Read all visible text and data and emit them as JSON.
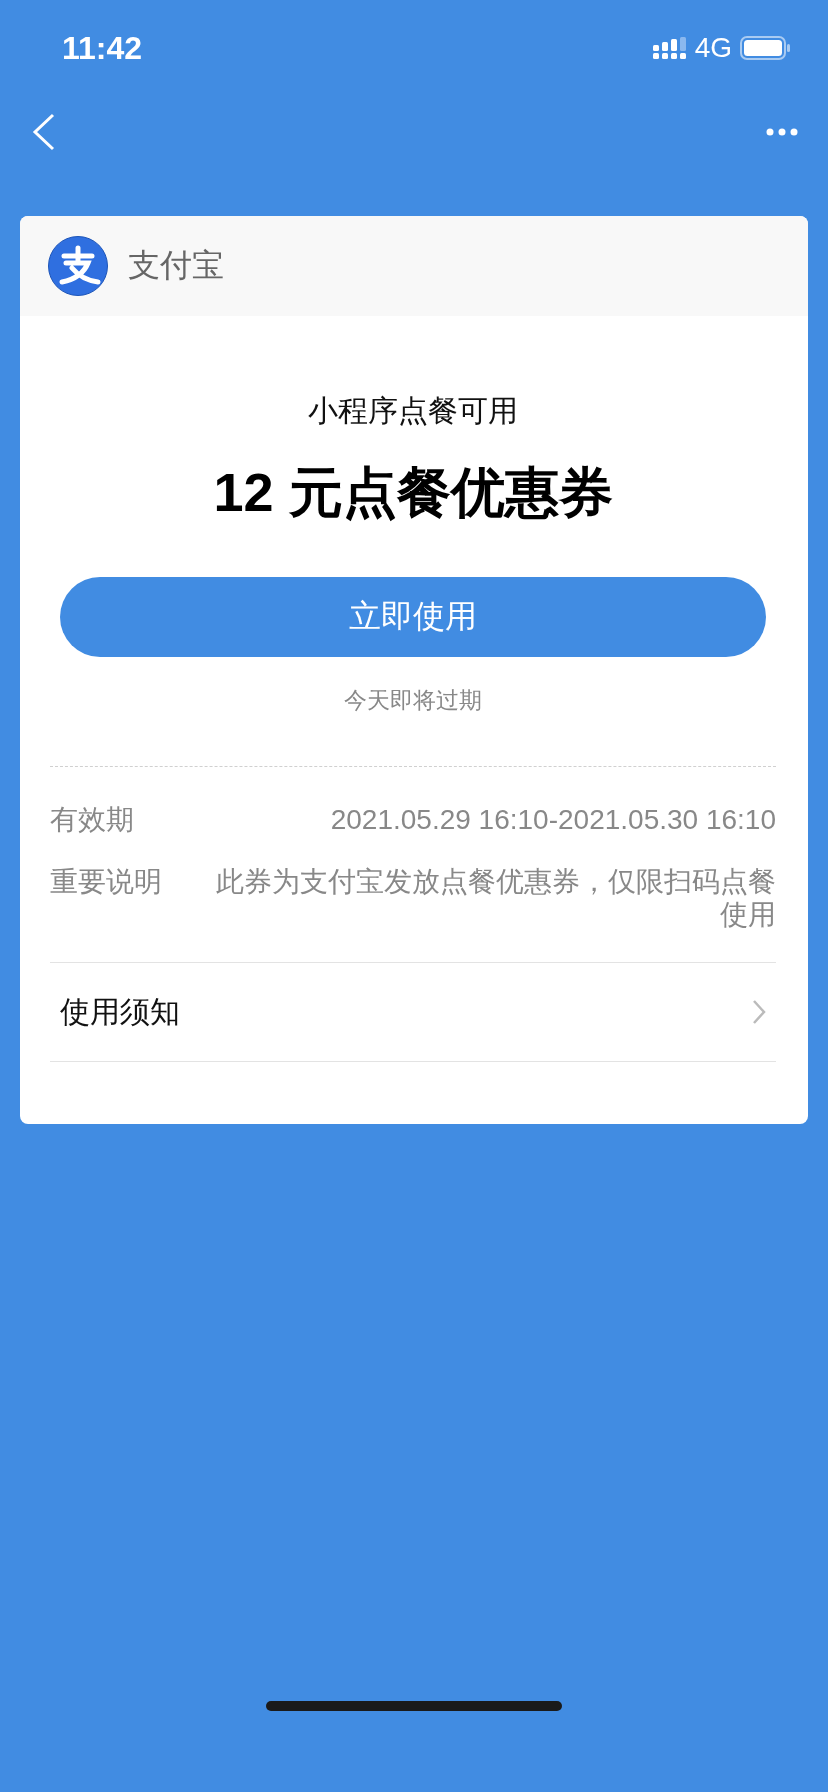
{
  "status_bar": {
    "time": "11:42",
    "network": "4G"
  },
  "card": {
    "brand": "支付宝",
    "subtitle": "小程序点餐可用",
    "title": "12 元点餐优惠券",
    "button": "立即使用",
    "expiry_note": "今天即将过期",
    "details": [
      {
        "label": "有效期",
        "value": "2021.05.29 16:10-2021.05.30 16:10"
      },
      {
        "label": "重要说明",
        "value": "此券为支付宝发放点餐优惠券，仅限扫码点餐使用"
      }
    ],
    "notice": {
      "label": "使用须知"
    }
  }
}
